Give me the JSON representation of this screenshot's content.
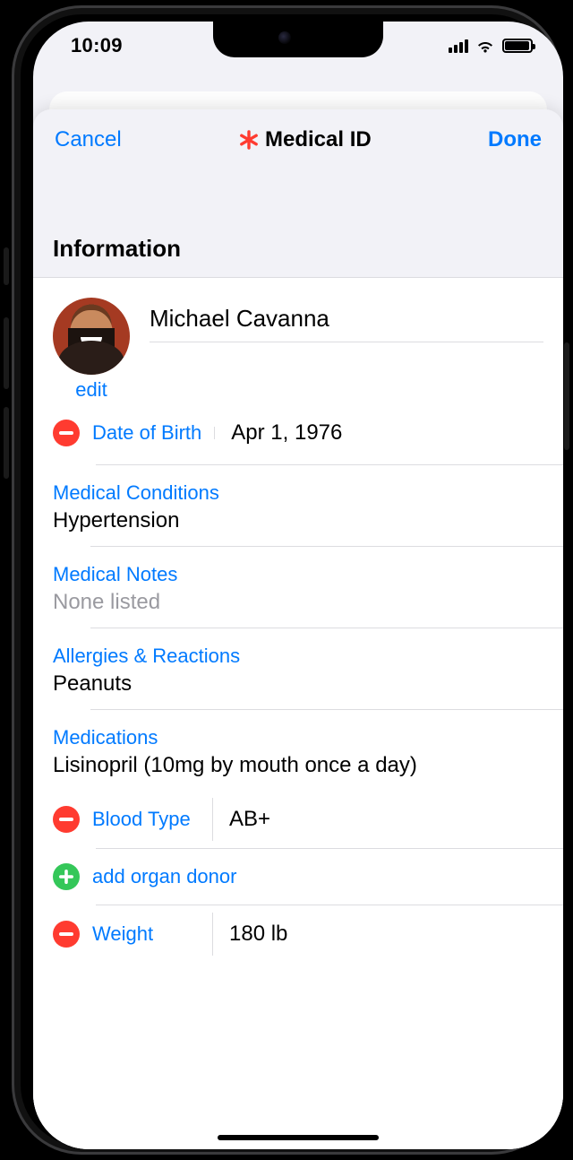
{
  "status": {
    "time": "10:09"
  },
  "nav": {
    "cancel": "Cancel",
    "title": "Medical ID",
    "done": "Done"
  },
  "section": {
    "information": "Information"
  },
  "profile": {
    "name": "Michael Cavanna",
    "edit": "edit"
  },
  "dob": {
    "label": "Date of Birth",
    "value": "Apr 1, 1976"
  },
  "conditions": {
    "label": "Medical Conditions",
    "value": "Hypertension"
  },
  "notes": {
    "label": "Medical Notes",
    "placeholder": "None listed"
  },
  "allergies": {
    "label": "Allergies & Reactions",
    "value": "Peanuts"
  },
  "medications": {
    "label": "Medications",
    "value": "Lisinopril (10mg by mouth once a day)"
  },
  "bloodType": {
    "label": "Blood Type",
    "value": "AB+"
  },
  "organDonor": {
    "add": "add organ donor"
  },
  "weight": {
    "label": "Weight",
    "value": "180 lb"
  }
}
